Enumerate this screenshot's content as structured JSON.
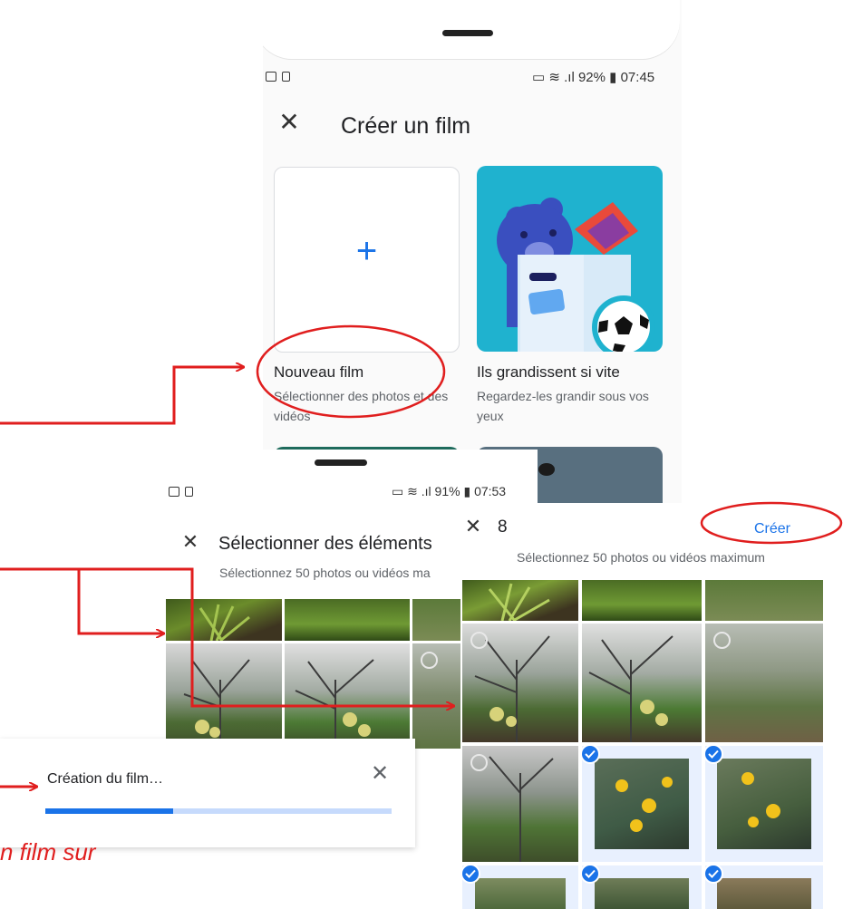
{
  "screen1": {
    "status_time": "07:45",
    "status_battery": "92%",
    "title": "Créer un film",
    "cards": [
      {
        "title": "Nouveau film",
        "subtitle": "Sélectionner des photos et des vidéos",
        "icon": "plus-icon"
      },
      {
        "title": "Ils grandissent si vite",
        "subtitle": "Regardez-les grandir sous vos yeux",
        "icon": "teddy-bear-illustration"
      }
    ]
  },
  "screen2": {
    "status_time": "07:53",
    "status_battery": "91%",
    "title": "Sélectionner des éléments",
    "subtitle": "Sélectionnez 50 photos ou vidéos ma"
  },
  "screen3": {
    "selected_count": "8",
    "create_label": "Créer",
    "subtitle": "Sélectionnez 50 photos ou vidéos maximum"
  },
  "dialog": {
    "text": "Création du film…",
    "progress_fraction": 0.37
  },
  "note": "n film sur",
  "colors": {
    "accent": "#1a73e8",
    "annotation": "#e01e1e",
    "selection_bg": "#e8f0fe"
  }
}
